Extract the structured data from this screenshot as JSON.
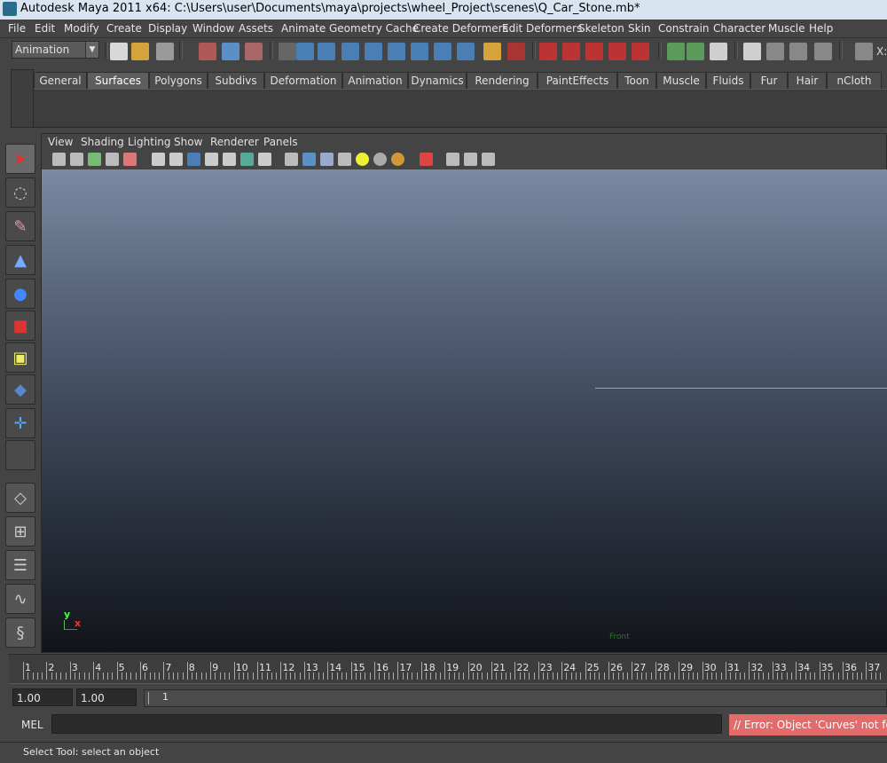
{
  "window": {
    "title": "Autodesk Maya 2011 x64: C:\\Users\\user\\Documents\\maya\\projects\\wheel_Project\\scenes\\Q_Car_Stone.mb*"
  },
  "menus": [
    "File",
    "Edit",
    "Modify",
    "Create",
    "Display",
    "Window",
    "Assets",
    "Animate",
    "Geometry Cache",
    "Create Deformers",
    "Edit Deformers",
    "Skeleton",
    "Skin",
    "Constrain",
    "Character",
    "Muscle",
    "Help"
  ],
  "status_line": {
    "mode": "Animation",
    "coord_label": "X:"
  },
  "shelf_tabs": [
    "General",
    "Surfaces",
    "Polygons",
    "Subdivs",
    "Deformation",
    "Animation",
    "Dynamics",
    "Rendering",
    "PaintEffects",
    "Toon",
    "Muscle",
    "Fluids",
    "Fur",
    "Hair",
    "nCloth"
  ],
  "shelf_active": "Surfaces",
  "panel_menus": [
    "View",
    "Shading",
    "Lighting",
    "Show",
    "Renderer",
    "Panels"
  ],
  "viewport": {
    "axis_y": "y",
    "axis_x": "x",
    "corner_label": "Front"
  },
  "timeline": {
    "ticks": [
      "1",
      "2",
      "3",
      "4",
      "5",
      "6",
      "7",
      "8",
      "9",
      "10",
      "11",
      "12",
      "13",
      "14",
      "15",
      "16",
      "17",
      "18",
      "19",
      "20",
      "21",
      "22",
      "23",
      "24",
      "25",
      "26",
      "27",
      "28",
      "29",
      "30",
      "31",
      "32",
      "33",
      "34",
      "35",
      "36",
      "37"
    ]
  },
  "range": {
    "start_time": "1.00",
    "start_range": "1.00",
    "range_value": "1"
  },
  "command": {
    "label": "MEL",
    "result": "// Error: Object 'Curves' not found."
  },
  "help_line": {
    "text": "Select Tool: select an object"
  },
  "colors": {
    "accent_error": "#e26b6b",
    "titlebar": "#d9e4f1",
    "ui_bg": "#444444"
  }
}
